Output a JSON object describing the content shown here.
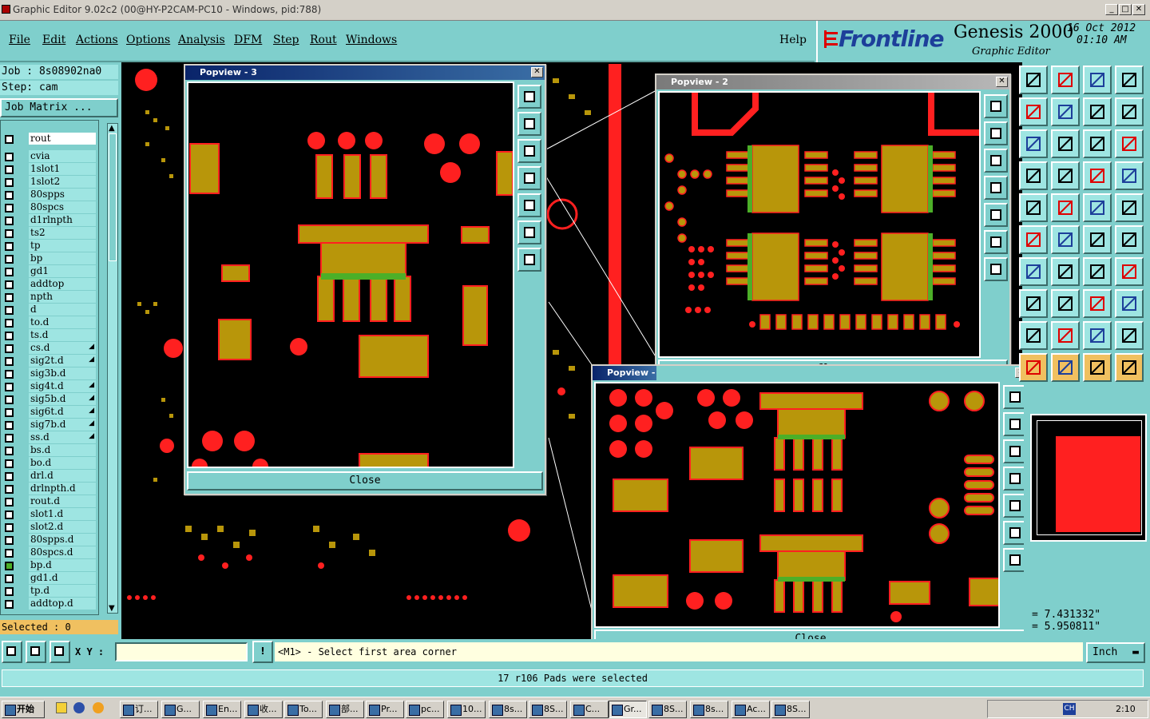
{
  "window": {
    "title": "Graphic Editor 9.02c2 (00@HY-P2CAM-PC10 - Windows, pid:788)",
    "min": "_",
    "max": "□",
    "close": "✕"
  },
  "menu": [
    "File",
    "Edit",
    "Actions",
    "Options",
    "Analysis",
    "DFM",
    "Step",
    "Rout",
    "Windows"
  ],
  "help": "Help",
  "brand": {
    "logo": "Frontline",
    "product": "Genesis 2000",
    "subtitle": "Graphic Editor",
    "date": "16 Oct 2012",
    "time": "01:10 AM"
  },
  "job": {
    "job_label": "Job : 8s08902na0",
    "step_label": "Step: cam",
    "matrix_button": "Job Matrix ..."
  },
  "layers": [
    {
      "name": "rout",
      "arrow": ""
    },
    {
      "name": "cvia",
      "arrow": ""
    },
    {
      "name": "1slot1",
      "arrow": ""
    },
    {
      "name": "1slot2",
      "arrow": ""
    },
    {
      "name": "80spps",
      "arrow": ""
    },
    {
      "name": "80spcs",
      "arrow": ""
    },
    {
      "name": "d1rlnpth",
      "arrow": ""
    },
    {
      "name": "ts2",
      "arrow": ""
    },
    {
      "name": "tp",
      "arrow": ""
    },
    {
      "name": "bp",
      "arrow": ""
    },
    {
      "name": "gd1",
      "arrow": ""
    },
    {
      "name": "addtop",
      "arrow": ""
    },
    {
      "name": "npth",
      "arrow": ""
    },
    {
      "name": "d",
      "arrow": ""
    },
    {
      "name": "to.d",
      "arrow": ""
    },
    {
      "name": "ts.d",
      "arrow": ""
    },
    {
      "name": "cs.d",
      "arrow": "◢"
    },
    {
      "name": "sig2t.d",
      "arrow": "◢"
    },
    {
      "name": "sig3b.d",
      "arrow": ""
    },
    {
      "name": "sig4t.d",
      "arrow": "◢"
    },
    {
      "name": "sig5b.d",
      "arrow": "◢"
    },
    {
      "name": "sig6t.d",
      "arrow": "◢"
    },
    {
      "name": "sig7b.d",
      "arrow": "◢"
    },
    {
      "name": "ss.d",
      "arrow": "◢"
    },
    {
      "name": "bs.d",
      "arrow": ""
    },
    {
      "name": "bo.d",
      "arrow": ""
    },
    {
      "name": "drl.d",
      "arrow": ""
    },
    {
      "name": "drlnpth.d",
      "arrow": ""
    },
    {
      "name": "rout.d",
      "arrow": ""
    },
    {
      "name": "slot1.d",
      "arrow": ""
    },
    {
      "name": "slot2.d",
      "arrow": ""
    },
    {
      "name": "80spps.d",
      "arrow": ""
    },
    {
      "name": "80spcs.d",
      "arrow": ""
    },
    {
      "name": "bp.d",
      "arrow": ""
    },
    {
      "name": "gd1.d",
      "arrow": ""
    },
    {
      "name": "tp.d",
      "arrow": ""
    },
    {
      "name": "addtop.d",
      "arrow": ""
    }
  ],
  "selected": "Selected : 0",
  "popviews": {
    "p3_title": "Popview - 3",
    "p2_title": "Popview - 2",
    "p1_title": "Popview -",
    "close": "Close"
  },
  "coords": {
    "x": "= 7.431332\"",
    "y": "= 5.950811\""
  },
  "command": {
    "xy_label": "X Y :",
    "xy_value": "",
    "prompt": "<M1> - Select first area corner",
    "units": "Inch"
  },
  "status": "17 r106 Pads were selected",
  "taskbar": {
    "start": "开始",
    "tasks": [
      "订...",
      "G...",
      "En...",
      "收...",
      "To...",
      "部...",
      "Pr...",
      "pc...",
      "10...",
      "8s...",
      "8S...",
      "C...",
      "Gr...",
      "8S...",
      "8s...",
      "Ac...",
      "8S..."
    ],
    "tray_lang": "CH",
    "clock": "2:10"
  },
  "colors": {
    "pad": "#b8960a",
    "outline": "#ff2020",
    "mask": "#4caf28",
    "bg": "#7fcfcc"
  }
}
